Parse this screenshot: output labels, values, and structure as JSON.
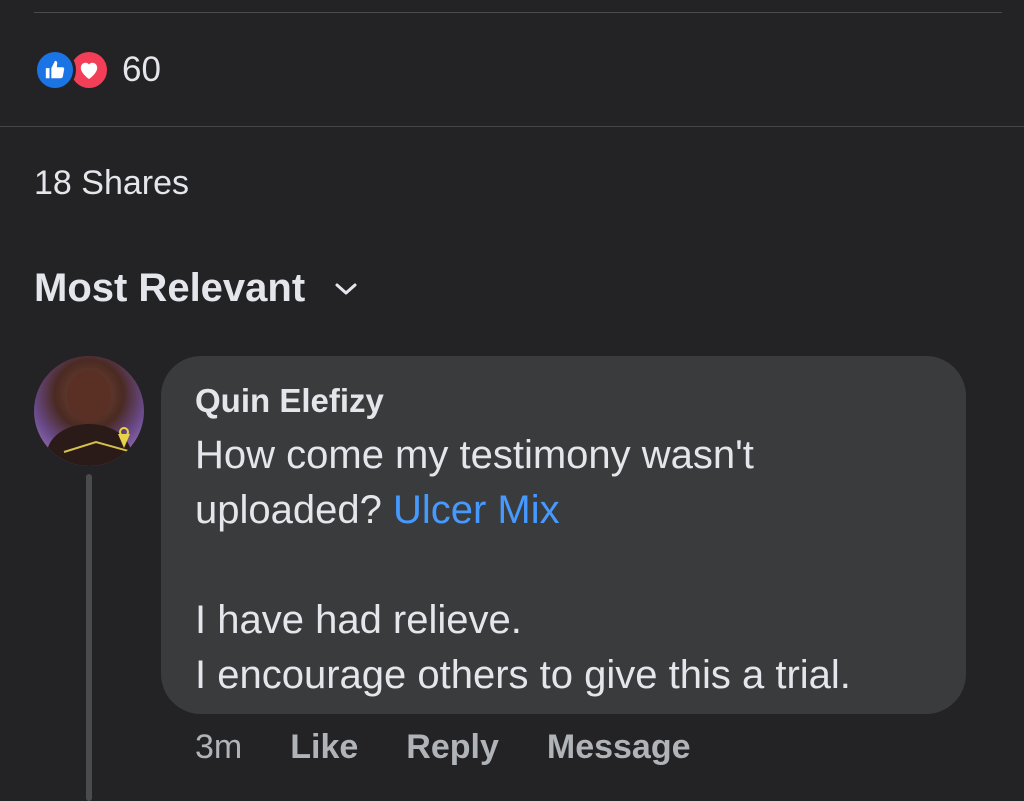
{
  "reactions": {
    "count": "60",
    "icons": [
      "like-icon",
      "love-icon"
    ],
    "like_color": "#1b74e4",
    "love_color": "#f33e58"
  },
  "shares": {
    "label": "18 Shares"
  },
  "sort": {
    "label": "Most Relevant",
    "icon": "chevron-down-icon"
  },
  "comment": {
    "author": "Quin Elefizy",
    "text_line1": "How come my testimony wasn't",
    "text_line2_prefix": "uploaded? ",
    "mention": "Ulcer Mix",
    "mention_color": "#4599ff",
    "text_line3": "I have had relieve.",
    "text_line4": "I encourage others to give this a trial.",
    "time": "3m",
    "like_label": "Like",
    "reply_label": "Reply",
    "message_label": "Message"
  }
}
